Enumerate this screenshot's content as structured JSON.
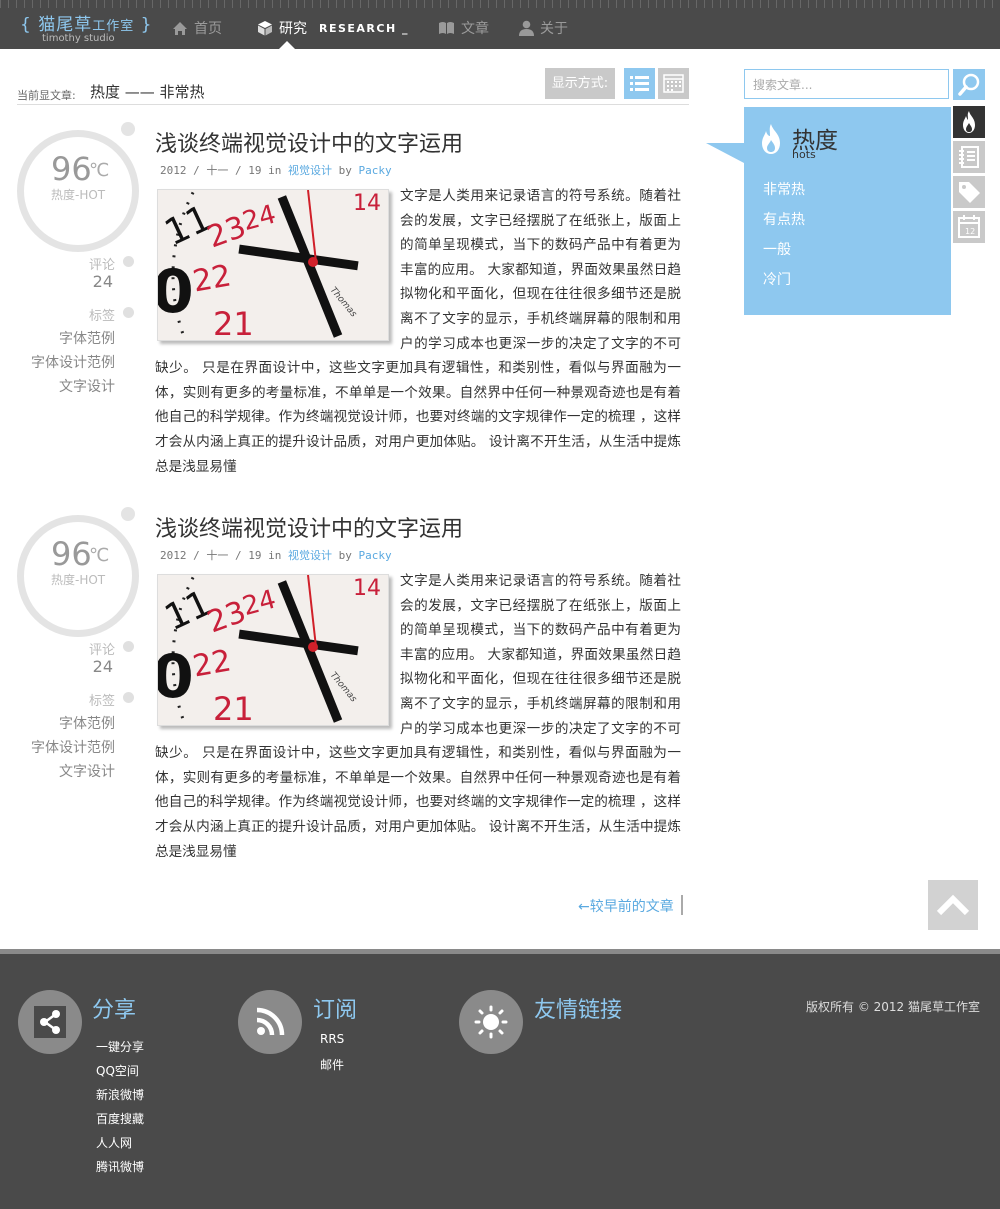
{
  "nav": {
    "logo_brackets_left": "{",
    "logo_main": "猫尾草",
    "logo_small": "工作室",
    "logo_brackets_right": "}",
    "logo_sub": "timothy studio",
    "items": [
      {
        "label": "首页",
        "icon": "home-icon"
      },
      {
        "label": "研究",
        "suffix": "RESEARCH _",
        "icon": "cube-icon",
        "active": true
      },
      {
        "label": "文章",
        "icon": "book-icon"
      },
      {
        "label": "关于",
        "icon": "user-icon"
      }
    ]
  },
  "filter": {
    "label": "当前显文章:",
    "value": "热度 —— 非常热",
    "display_label": "显示方式:"
  },
  "articles": [
    {
      "gauge_value": "96",
      "gauge_unit": "℃",
      "gauge_label": "热度-HOT",
      "comment_label": "评论",
      "comment_count": "24",
      "tag_label": "标签",
      "tags": [
        "字体范例",
        "字体设计范例",
        "文字设计"
      ],
      "title": "浅谈终端视觉设计中的文字运用",
      "date": "2012 / 十一 / 19",
      "in_text": "in",
      "category": "视觉设计",
      "by_text": "by",
      "author": "Packy",
      "body": "文字是人类用来记录语言的符号系统。随着社会的发展，文字已经摆脱了在纸张上，版面上的简单呈现模式，当下的数码产品中有着更为丰富的应用。 大家都知道，界面效果虽然日趋拟物化和平面化，但现在往往很多细节还是脱离不了文字的显示，手机终端屏幕的限制和用户的学习成本也更深一步的决定了文字的不可缺少。 只是在界面设计中，这些文字更加具有逻辑性，和类别性，看似与界面融为一体，实则有更多的考量标准，不单单是一个效果。自然界中任何一种景观奇迹也是有着他自己的科学规律。作为终端视觉设计师，也要对终端的文字规律作一定的梳理 ，这样才会从内涵上真正的提升设计品质，对用户更加体贴。 设计离不开生活，从生活中提炼总是浅显易懂"
    },
    {
      "gauge_value": "96",
      "gauge_unit": "℃",
      "gauge_label": "热度-HOT",
      "comment_label": "评论",
      "comment_count": "24",
      "tag_label": "标签",
      "tags": [
        "字体范例",
        "字体设计范例",
        "文字设计"
      ],
      "title": "浅谈终端视觉设计中的文字运用",
      "date": "2012 / 十一 / 19",
      "in_text": "in",
      "category": "视觉设计",
      "by_text": "by",
      "author": "Packy",
      "body": "文字是人类用来记录语言的符号系统。随着社会的发展，文字已经摆脱了在纸张上，版面上的简单呈现模式，当下的数码产品中有着更为丰富的应用。 大家都知道，界面效果虽然日趋拟物化和平面化，但现在往往很多细节还是脱离不了文字的显示，手机终端屏幕的限制和用户的学习成本也更深一步的决定了文字的不可缺少。 只是在界面设计中，这些文字更加具有逻辑性，和类别性，看似与界面融为一体，实则有更多的考量标准，不单单是一个效果。自然界中任何一种景观奇迹也是有着他自己的科学规律。作为终端视觉设计师，也要对终端的文字规律作一定的梳理 ，这样才会从内涵上真正的提升设计品质，对用户更加体贴。 设计离不开生活，从生活中提炼总是浅显易懂"
    }
  ],
  "sidebar": {
    "search_placeholder": "搜索文章...",
    "hot_title": "热度",
    "hot_sub": "hots",
    "hot_items": [
      "非常热",
      "有点热",
      "一般",
      "冷门"
    ],
    "tabs": [
      "flame-icon",
      "notebook-icon",
      "tag-icon",
      "calendar-icon"
    ]
  },
  "pager": {
    "older": "←较早前的文章"
  },
  "footer": {
    "share_title": "分享",
    "share_links": [
      "一键分享",
      "QQ空间",
      "新浪微博",
      "百度搜藏",
      "人人网",
      "腾讯微博"
    ],
    "subscribe_title": "订阅",
    "subscribe_links": [
      "RRS",
      "邮件"
    ],
    "friends_title": "友情链接",
    "copyright": "版权所有 © 2012 猫尾草工作室"
  },
  "colors": {
    "accent": "#8ec8ef",
    "nav_bg": "#4a4a4a",
    "link": "#5aa9e0"
  }
}
